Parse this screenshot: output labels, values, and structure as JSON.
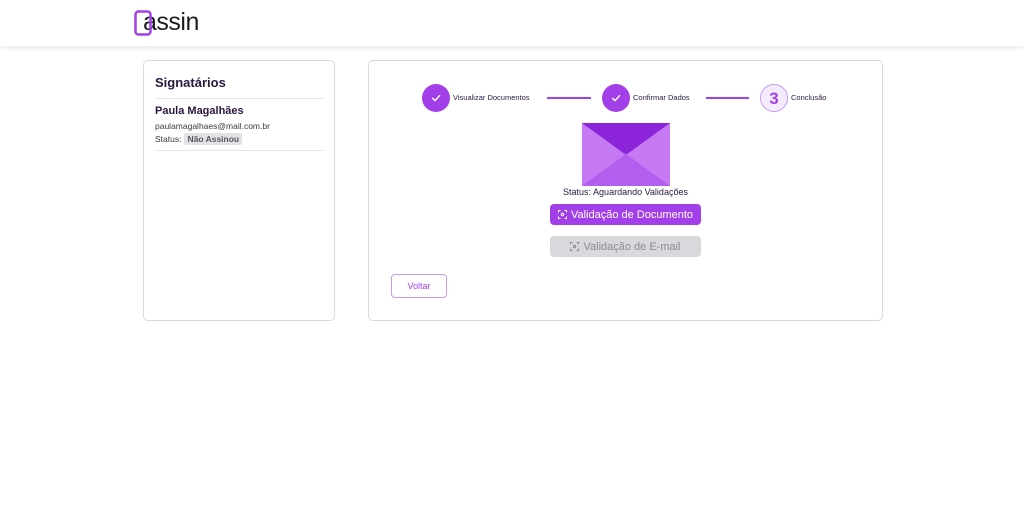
{
  "app": {
    "logo_text": "assin"
  },
  "signatories": {
    "title": "Signatários",
    "items": [
      {
        "name": "Paula Magalhães",
        "email": "paulamagalhaes@mail.com.br",
        "status_label": "Status:",
        "status_value": "Não Assinou"
      }
    ]
  },
  "stepper": {
    "steps": [
      {
        "label": "Visualizar Documentos",
        "state": "done"
      },
      {
        "label": "Confirmar Dados",
        "state": "done"
      },
      {
        "label": "Conclusão",
        "state": "current",
        "number": "3"
      }
    ]
  },
  "main": {
    "envelope_icon": "envelope-icon",
    "status_text": "Status: Aguardando Validações",
    "btn_document_validation": "Validação de Documento",
    "btn_email_validation": "Validação de E-mail",
    "btn_back": "Voltar"
  },
  "colors": {
    "accent": "#a33fe8",
    "disabled_bg": "#d9d9dd",
    "text_dark": "#2a1740"
  }
}
